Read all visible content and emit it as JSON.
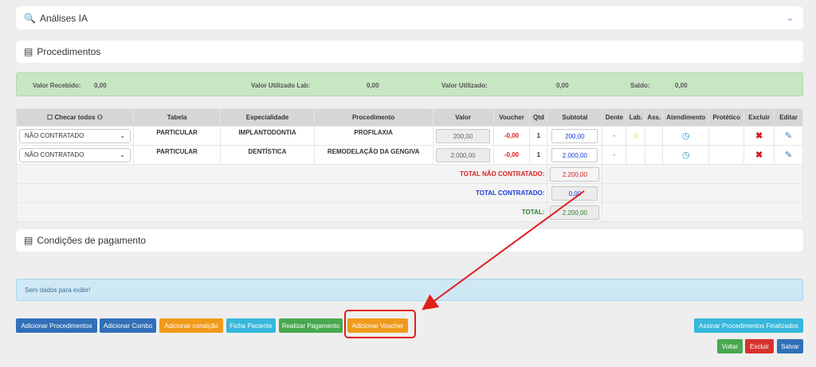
{
  "panels": {
    "ai": {
      "title": "Análises IA"
    },
    "procedimentos": {
      "title": "Procedimentos"
    },
    "condicoes": {
      "title": "Condições de pagamento"
    }
  },
  "summary": {
    "valor_recebido_label": "Valor Recebido:",
    "valor_recebido": "0,00",
    "valor_lab_label": "Valor Utilizado Lab:",
    "valor_lab": "0,00",
    "valor_utilizado_label": "Valor Utilizado:",
    "valor_utilizado": "0,00",
    "saldo_label": "Saldo:",
    "saldo": "0,00"
  },
  "table": {
    "check_all": "Checar todos",
    "headers": [
      "Tabela",
      "Especialidade",
      "Procedimento",
      "Valor",
      "Voucher",
      "Qtd",
      "Subtotal",
      "Dente",
      "Lab.",
      "Ass.",
      "Atendimento",
      "Protético",
      "Excluir",
      "Editar"
    ],
    "rows": [
      {
        "status": "NÃO CONTRATADO",
        "tabela": "PARTICULAR",
        "especialidade": "IMPLANTODONTIA",
        "procedimento": "PROFILAXIA",
        "valor": "200,00",
        "voucher": "-0,00",
        "qtd": "1",
        "subtotal": "200,00",
        "dente": "-"
      },
      {
        "status": "NÃO CONTRATADO",
        "tabela": "PARTICULAR",
        "especialidade": "DENTÍSTICA",
        "procedimento": "REMODELAÇÃO DA GENGIVA",
        "valor": "2.000,00",
        "voucher": "-0,00",
        "qtd": "1",
        "subtotal": "2.000,00",
        "dente": "-"
      }
    ],
    "totals": {
      "nao_contratado_label": "TOTAL NÃO CONTRATADO:",
      "nao_contratado": "2.200,00",
      "contratado_label": "TOTAL CONTRATADO:",
      "contratado": "0,00",
      "total_label": "TOTAL:",
      "total": "2.200,00"
    }
  },
  "empty_message": "Sem dados para exibir!",
  "buttons": {
    "adicionar_procedimentos": "Adicionar Procedimentos",
    "adicionar_combo": "Adicionar Combo",
    "adicionar_condicao": "Adicionar condição",
    "ficha_paciente": "Ficha Paciente",
    "realizar_pagamento": "Realizar Pagamento",
    "adicionar_voucher": "Adicionar Voucher",
    "assinar": "Assinar Procedimentos Finalizados",
    "voltar": "Voltar",
    "excluir": "Excluir",
    "salvar": "Salvar"
  },
  "icons": {
    "ai": "magnifier-robot-icon",
    "list": "list-icon",
    "chevron": "chevron-down-icon",
    "lab": "house-icon",
    "atendimento": "clock-icon",
    "excluir": "x-icon",
    "editar": "edit-icon"
  },
  "colors": {
    "primary": "#3170b8",
    "warning": "#f09a1b",
    "info": "#35b8dc",
    "success": "#48a84f",
    "danger": "#d6332f",
    "summary_bg": "#c7e6c2",
    "empty_bg": "#cfe8f6",
    "annotation": "#e0201b"
  }
}
